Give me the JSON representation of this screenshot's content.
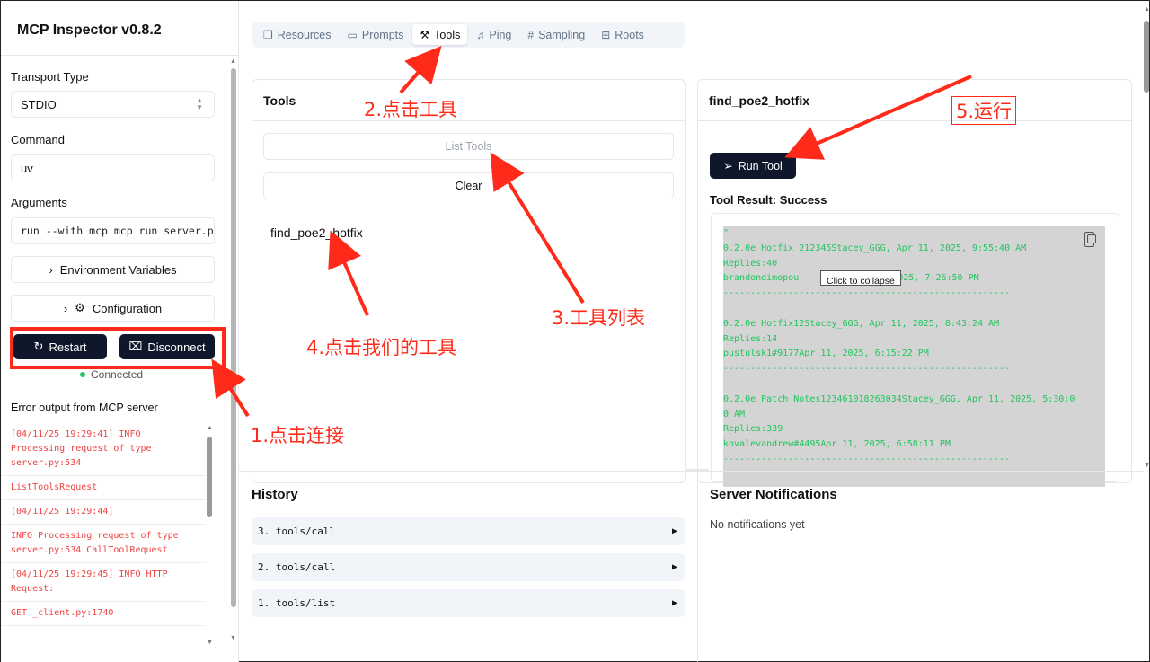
{
  "sidebar": {
    "title": "MCP Inspector v0.8.2",
    "transport_label": "Transport Type",
    "transport_value": "STDIO",
    "command_label": "Command",
    "command_value": "uv",
    "arguments_label": "Arguments",
    "arguments_value": "run --with mcp mcp run server.py",
    "env_label": "Environment Variables",
    "config_label": "Configuration",
    "restart_label": "Restart",
    "disconnect_label": "Disconnect",
    "status": "Connected",
    "error_title": "Error output from MCP server",
    "logs": [
      "[04/11/25 19:29:41] INFO Processing request of type server.py:534",
      "ListToolsRequest",
      "[04/11/25 19:29:44]",
      "INFO Processing request of type server.py:534 CallToolRequest",
      "[04/11/25 19:29:45] INFO HTTP Request:",
      "GET _client.py:1740"
    ]
  },
  "tabs": [
    "Resources",
    "Prompts",
    "Tools",
    "Ping",
    "Sampling",
    "Roots"
  ],
  "tools_panel": {
    "title": "Tools",
    "list_label": "List Tools",
    "clear_label": "Clear",
    "tool_name": "find_poe2_hotfix"
  },
  "detail_panel": {
    "title": "find_poe2_hotfix",
    "run_label": "Run Tool",
    "result_title": "Tool Result: Success",
    "tooltip": "Click to collapse",
    "result_lines": [
      "\"",
      "0.2.0e Hotfix 212345Stacey_GGG, Apr 11, 2025, 9:55:40 AM",
      "Replies:40",
      "brandondimopou",
      "",
      "",
      "0.2.0e Hotfix12Stacey_GGG, Apr 11, 2025, 8:43:24 AM",
      "Replies:14",
      "pustulsk1#9177Apr 11, 2025, 6:15:22 PM",
      "-----------------------------------------------------",
      "",
      "0.2.0e Patch Notes123461018263034Stacey_GGG, Apr 11, 2025, 5:30:0",
      "0 AM",
      "Replies:339",
      "kovalevandrew#4495Apr 11, 2025, 6:58:11 PM",
      "-----------------------------------------------------"
    ],
    "line3_tail": "2025, 7:26:50 PM",
    "line4": "-----------------------------------------------------"
  },
  "history": {
    "title": "History",
    "items": [
      "3. tools/call",
      "2. tools/call",
      "1. tools/list"
    ]
  },
  "notifications": {
    "title": "Server Notifications",
    "empty": "No notifications yet"
  },
  "annotations": {
    "a1": "1.点击连接",
    "a2": "2.点击工具",
    "a3": "3.工具列表",
    "a4": "4.点击我们的工具",
    "a5": "5.运行"
  },
  "colors": {
    "annotation": "#ff2a1a",
    "dark_button": "#0f172a",
    "log_text": "#ef4444",
    "result_text": "#22c55e"
  }
}
